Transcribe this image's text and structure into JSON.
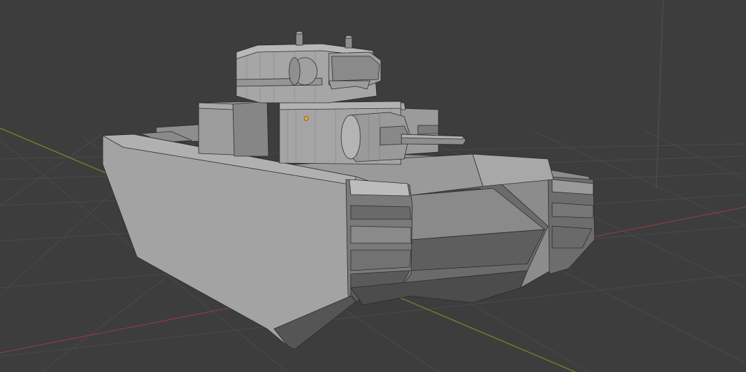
{
  "viewport": {
    "mode": "object",
    "shading": "solid",
    "background_color": "#3d3d3d",
    "grid_color": "#4a4a4a",
    "x_axis_color": "#8a3b40",
    "y_axis_color": "#6b8a2e",
    "z_axis_color": "#4f4f4f",
    "origin_color": "#f2a540"
  },
  "scene": {
    "object": "tank-model",
    "selected": false,
    "icons": [
      "object-origin-icon"
    ]
  }
}
